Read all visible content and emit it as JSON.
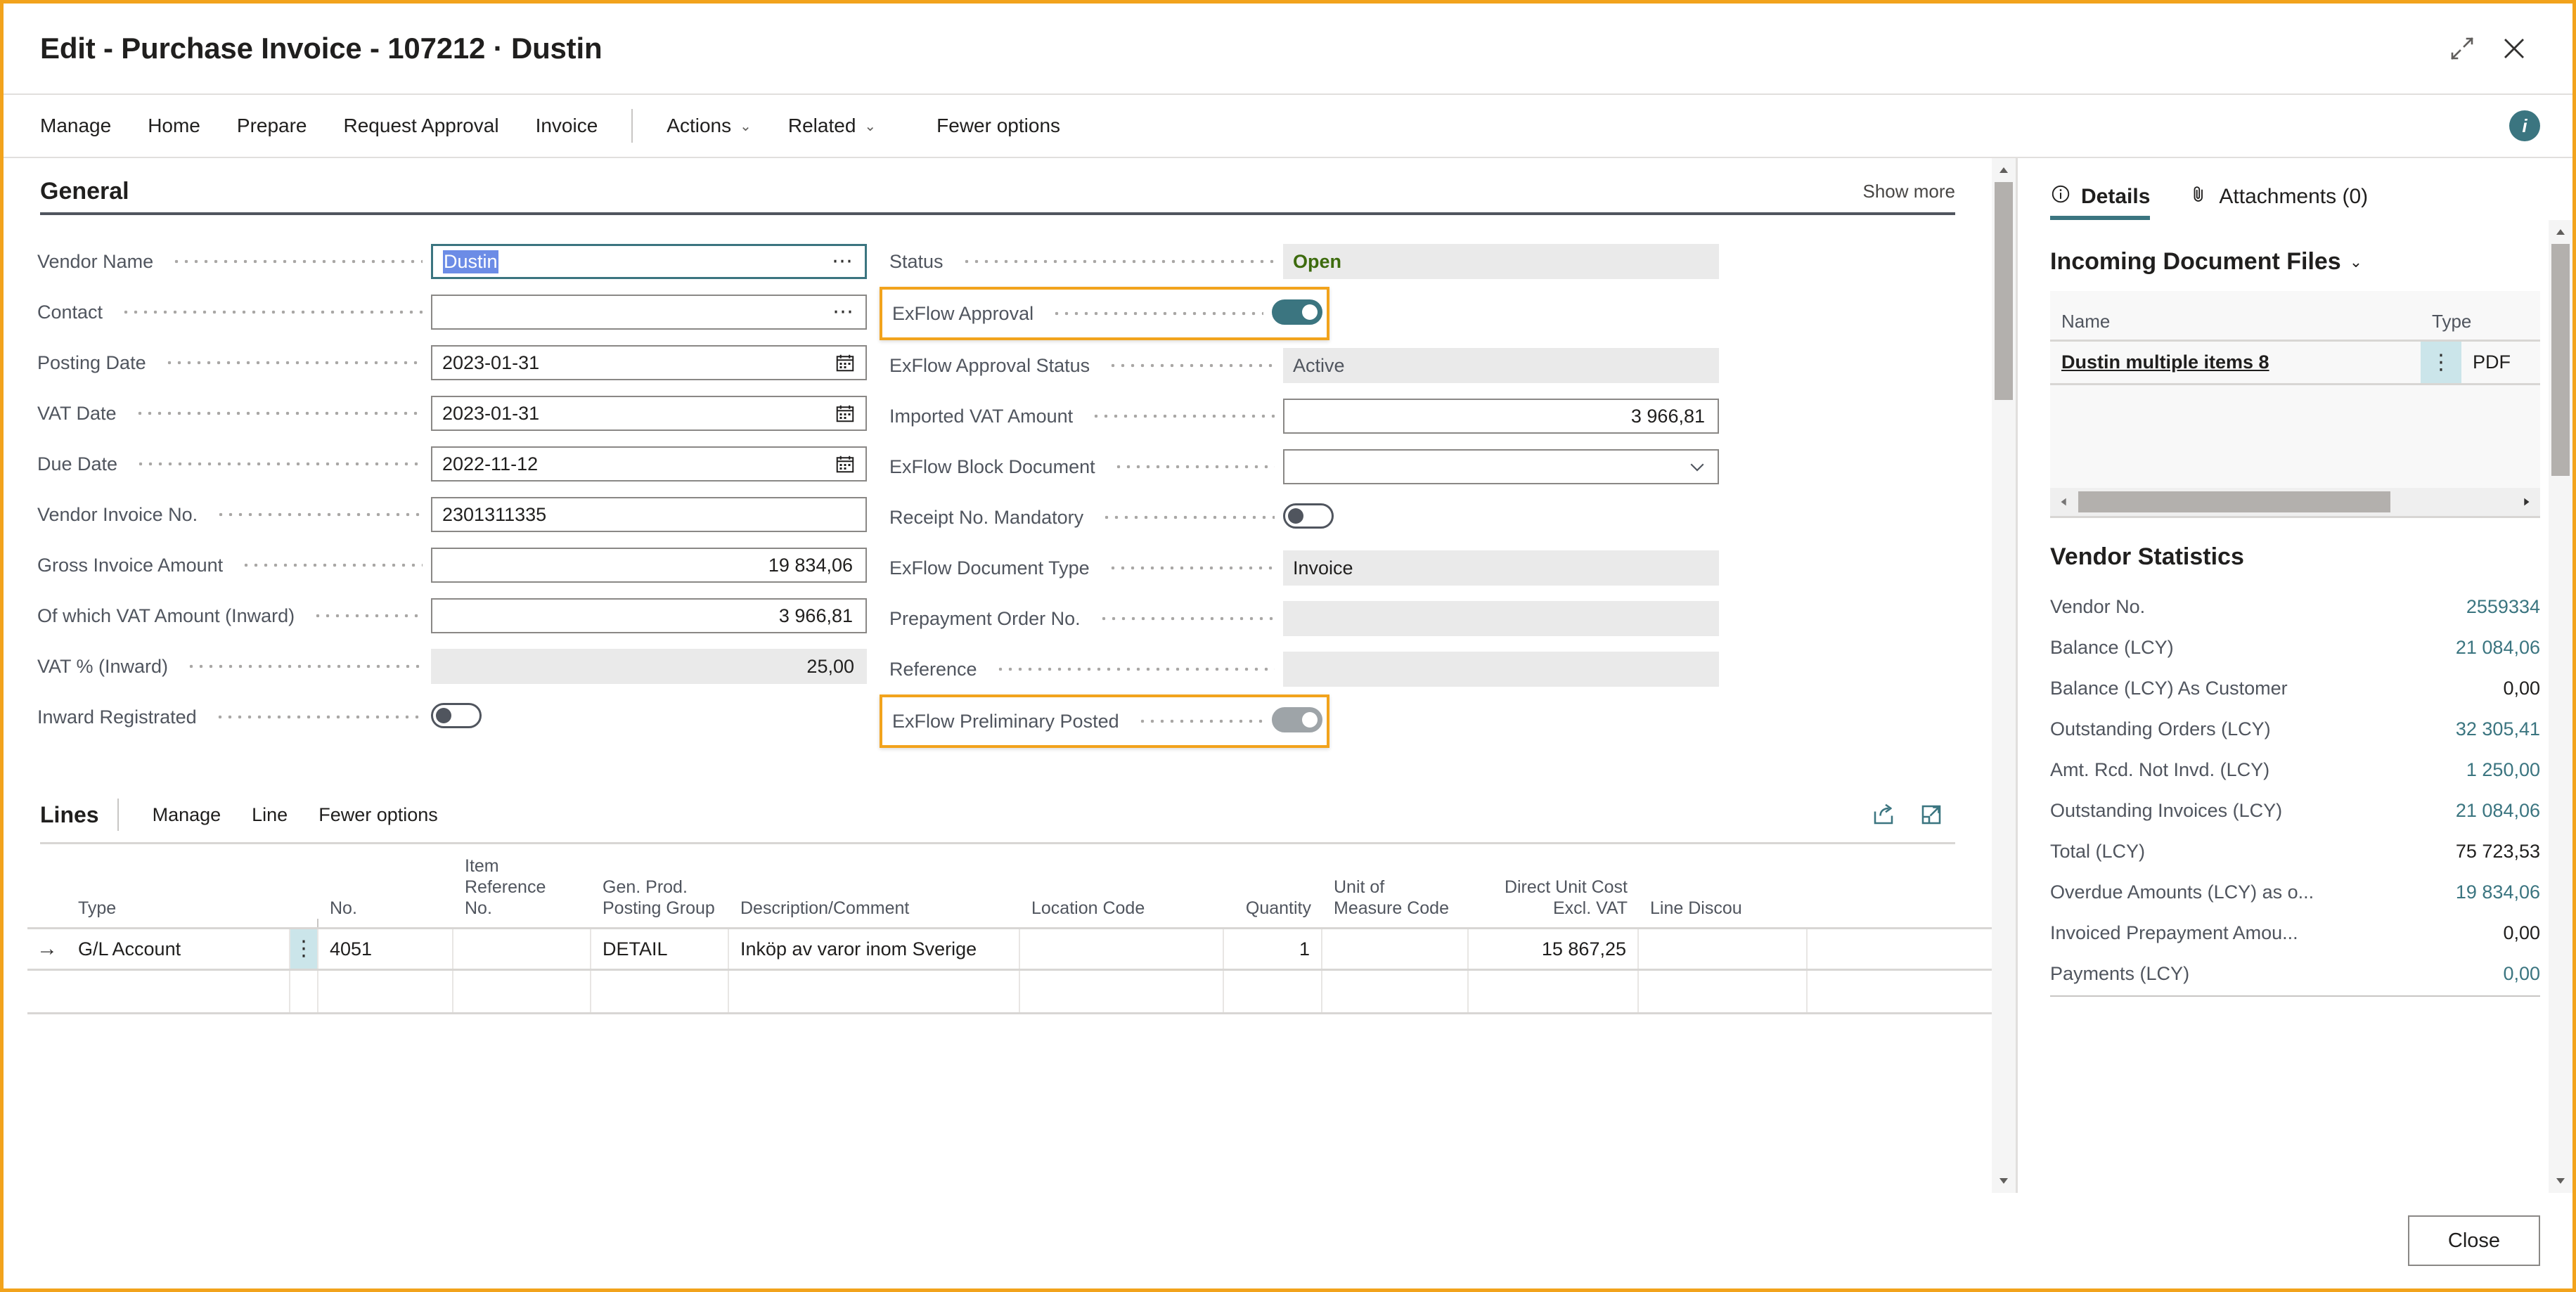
{
  "window": {
    "title": "Edit - Purchase Invoice - 107212 · Dustin",
    "restore_icon": "restore-down-icon",
    "close_icon": "close-icon",
    "accent_orange": "#f2a31c",
    "accent_teal": "#3b7580"
  },
  "ribbon": {
    "items": [
      "Manage",
      "Home",
      "Prepare",
      "Request Approval",
      "Invoice"
    ],
    "dropdowns": [
      "Actions",
      "Related"
    ],
    "fewer_options": "Fewer options",
    "info_badge": "i"
  },
  "general": {
    "title": "General",
    "show_more": "Show more",
    "left_fields": [
      {
        "label": "Vendor Name",
        "value": "Dustin",
        "kind": "lookup",
        "selected": true
      },
      {
        "label": "Contact",
        "value": "",
        "kind": "lookup"
      },
      {
        "label": "Posting Date",
        "value": "2023-01-31",
        "kind": "date"
      },
      {
        "label": "VAT Date",
        "value": "2023-01-31",
        "kind": "date"
      },
      {
        "label": "Due Date",
        "value": "2022-11-12",
        "kind": "date"
      },
      {
        "label": "Vendor Invoice No.",
        "value": "2301311335",
        "kind": "text"
      },
      {
        "label": "Gross Invoice Amount",
        "value": "19 834,06",
        "kind": "number"
      },
      {
        "label": "Of which VAT Amount (Inward)",
        "value": "3 966,81",
        "kind": "number"
      },
      {
        "label": "VAT % (Inward)",
        "value": "25,00",
        "kind": "readonly-number"
      },
      {
        "label": "Inward Registrated",
        "value": "",
        "kind": "toggle",
        "on": false
      }
    ],
    "right_fields": [
      {
        "label": "Status",
        "value": "Open",
        "kind": "readonly-green"
      },
      {
        "label": "ExFlow Approval",
        "value": "",
        "kind": "toggle",
        "on": true,
        "highlight": true
      },
      {
        "label": "ExFlow Approval Status",
        "value": "Active",
        "kind": "readonly"
      },
      {
        "label": "Imported VAT Amount",
        "value": "3 966,81",
        "kind": "number"
      },
      {
        "label": "ExFlow Block Document",
        "value": "",
        "kind": "dropdown"
      },
      {
        "label": "Receipt No. Mandatory",
        "value": "",
        "kind": "toggle",
        "on": false
      },
      {
        "label": "ExFlow Document Type",
        "value": "Invoice",
        "kind": "readonly"
      },
      {
        "label": "Prepayment Order No.",
        "value": "",
        "kind": "readonly"
      },
      {
        "label": "Reference",
        "value": "",
        "kind": "readonly"
      },
      {
        "label": "ExFlow Preliminary Posted",
        "value": "",
        "kind": "toggle",
        "on": true,
        "dim": true,
        "highlight": true
      }
    ]
  },
  "lines": {
    "title": "Lines",
    "menu": [
      "Manage",
      "Line",
      "Fewer options"
    ],
    "share_icon": "share-icon",
    "expand_icon": "open-in-new-window-icon",
    "columns": [
      "Type",
      "No.",
      "Item Reference\nNo.",
      "Gen. Prod.\nPosting Group",
      "Description/Comment",
      "Location Code",
      "Quantity",
      "Unit of\nMeasure Code",
      "Direct Unit Cost\nExcl. VAT",
      "Line Discou"
    ],
    "rows": [
      {
        "row_indicator": "→",
        "type": "G/L Account",
        "no": "4051",
        "item_reference_no": "",
        "gen_prod_posting_group": "DETAIL",
        "description": "Inköp av varor inom Sverige",
        "location_code": "",
        "quantity": "1",
        "unit_of_measure_code": "",
        "direct_unit_cost_excl_vat": "15 867,25",
        "line_discount": ""
      }
    ]
  },
  "factbox": {
    "tabs": [
      {
        "label": "Details",
        "icon": "info-circle-icon",
        "active": true
      },
      {
        "label": "Attachments (0)",
        "icon": "paperclip-icon",
        "active": false
      }
    ],
    "incoming_document_files": {
      "title": "Incoming Document Files",
      "chevron": "chevron-down-icon",
      "columns": [
        "Name",
        "Type"
      ],
      "rows": [
        {
          "name": "Dustin multiple items 8",
          "type": "PDF",
          "kebab": "more-options-icon"
        }
      ]
    },
    "vendor_statistics": {
      "title": "Vendor Statistics",
      "rows": [
        {
          "label": "Vendor No.",
          "value": "2559334",
          "link": true
        },
        {
          "label": "Balance (LCY)",
          "value": "21 084,06",
          "link": true
        },
        {
          "label": "Balance (LCY) As Customer",
          "value": "0,00",
          "link": false
        },
        {
          "label": "Outstanding Orders (LCY)",
          "value": "32 305,41",
          "link": true
        },
        {
          "label": "Amt. Rcd. Not Invd. (LCY)",
          "value": "1 250,00",
          "link": true
        },
        {
          "label": "Outstanding Invoices (LCY)",
          "value": "21 084,06",
          "link": true
        },
        {
          "label": "Total (LCY)",
          "value": "75 723,53",
          "link": false
        },
        {
          "label": "Overdue Amounts (LCY) as o...",
          "value": "19 834,06",
          "link": true
        },
        {
          "label": "Invoiced Prepayment Amou...",
          "value": "0,00",
          "link": false
        },
        {
          "label": "Payments (LCY)",
          "value": "0,00",
          "link": true
        }
      ]
    }
  },
  "footer": {
    "close_label": "Close"
  }
}
